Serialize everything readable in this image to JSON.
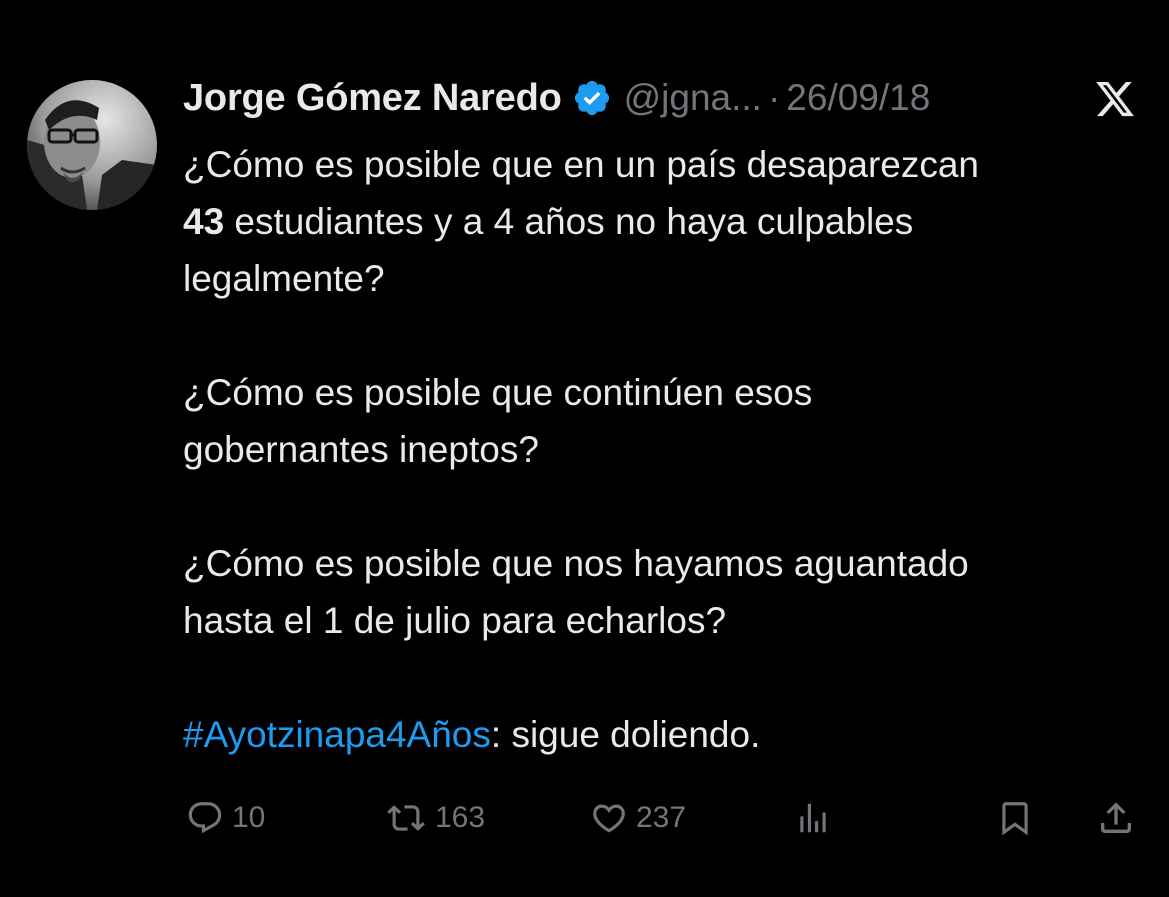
{
  "author": {
    "name": "Jorge Gómez Naredo",
    "handle": "@jgna...",
    "separator": "·",
    "date": "26/09/18",
    "verified": true
  },
  "platform_logo": "x-logo-icon",
  "tweet_lines": {
    "l1": "¿Cómo es posible que en un país desaparezcan",
    "l2_bold": "43",
    "l2_rest": " estudiantes y a 4 años no haya culpables",
    "l3": "legalmente?",
    "l4": "¿Cómo es posible que continúen esos",
    "l5": "gobernantes ineptos?",
    "l6": "¿Cómo es posible que nos hayamos aguantado",
    "l7": "hasta el 1 de julio para echarlos?",
    "l8_hashtag": "#Ayotzinapa4Años",
    "l8_rest": ": sigue doliendo."
  },
  "actions": {
    "replies": "10",
    "reposts": "163",
    "likes": "237"
  },
  "colors": {
    "background": "#000000",
    "text": "#e7e9ea",
    "muted": "#71767b",
    "accent": "#1d9bf0"
  },
  "icons": [
    "reply-icon",
    "repost-icon",
    "like-icon",
    "views-icon",
    "bookmark-icon",
    "share-icon",
    "verified-badge-icon",
    "x-logo-icon"
  ]
}
